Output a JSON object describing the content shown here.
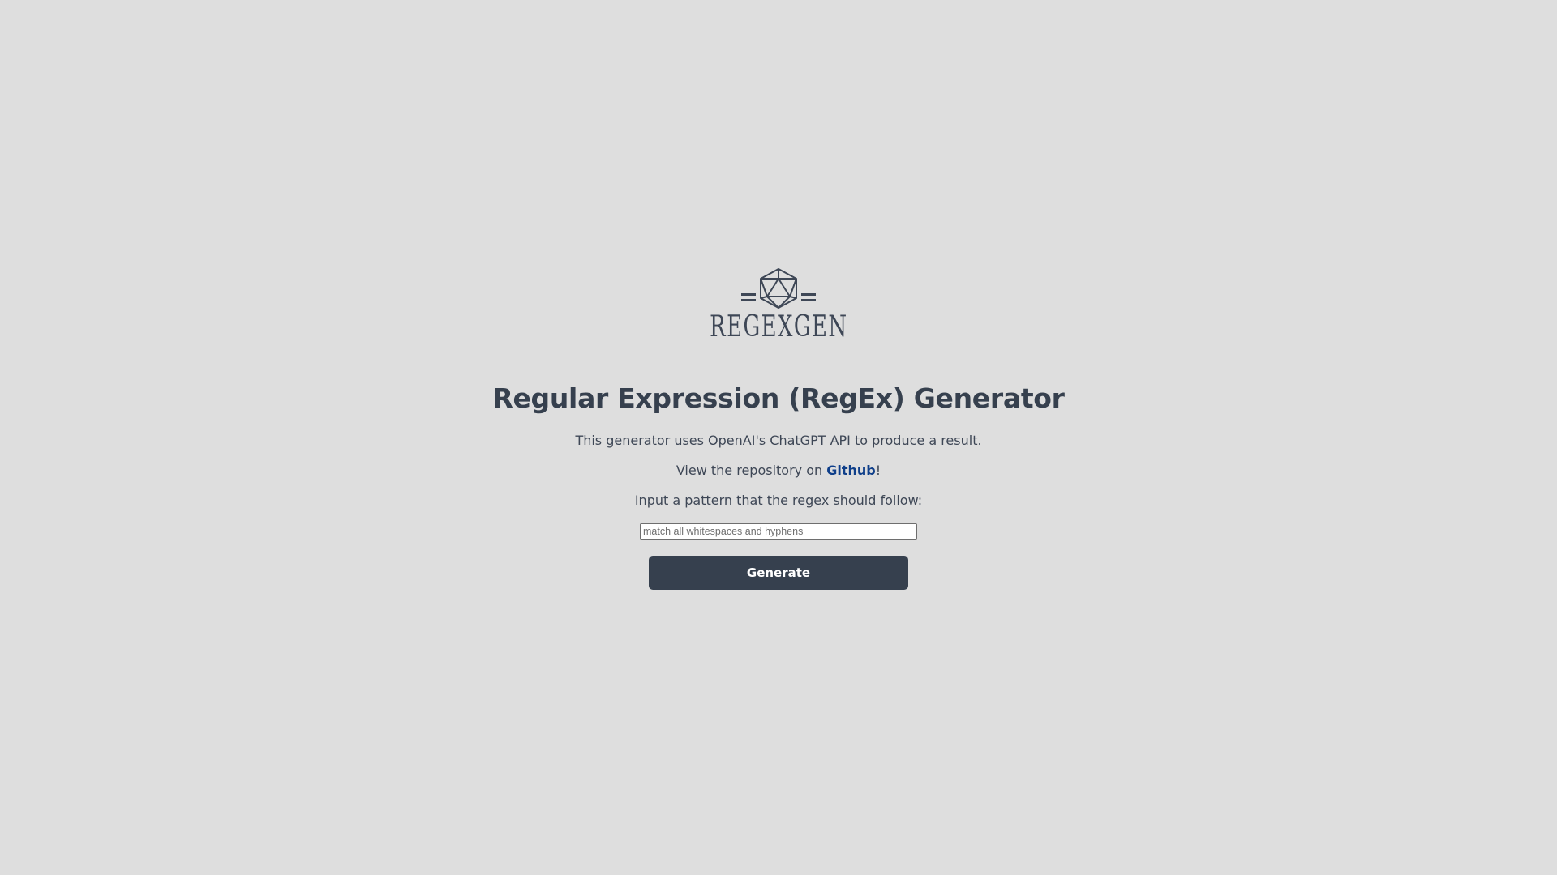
{
  "logo": {
    "text": "REGEXGEN",
    "icon": "icosahedron-icon",
    "color": "#3e4756"
  },
  "heading": "Regular Expression (RegEx) Generator",
  "description": "This generator uses OpenAI's ChatGPT API to produce a result.",
  "repository": {
    "prefix": "View the repository on ",
    "link_text": "Github",
    "suffix": "!"
  },
  "prompt_label": "Input a pattern that the regex should follow:",
  "pattern_input": {
    "placeholder": "match all whitespaces and hyphens",
    "value": ""
  },
  "generate_button": "Generate",
  "colors": {
    "background": "#dedede",
    "text": "#36404e",
    "link": "#0f3f8a",
    "button": "#36404e"
  }
}
